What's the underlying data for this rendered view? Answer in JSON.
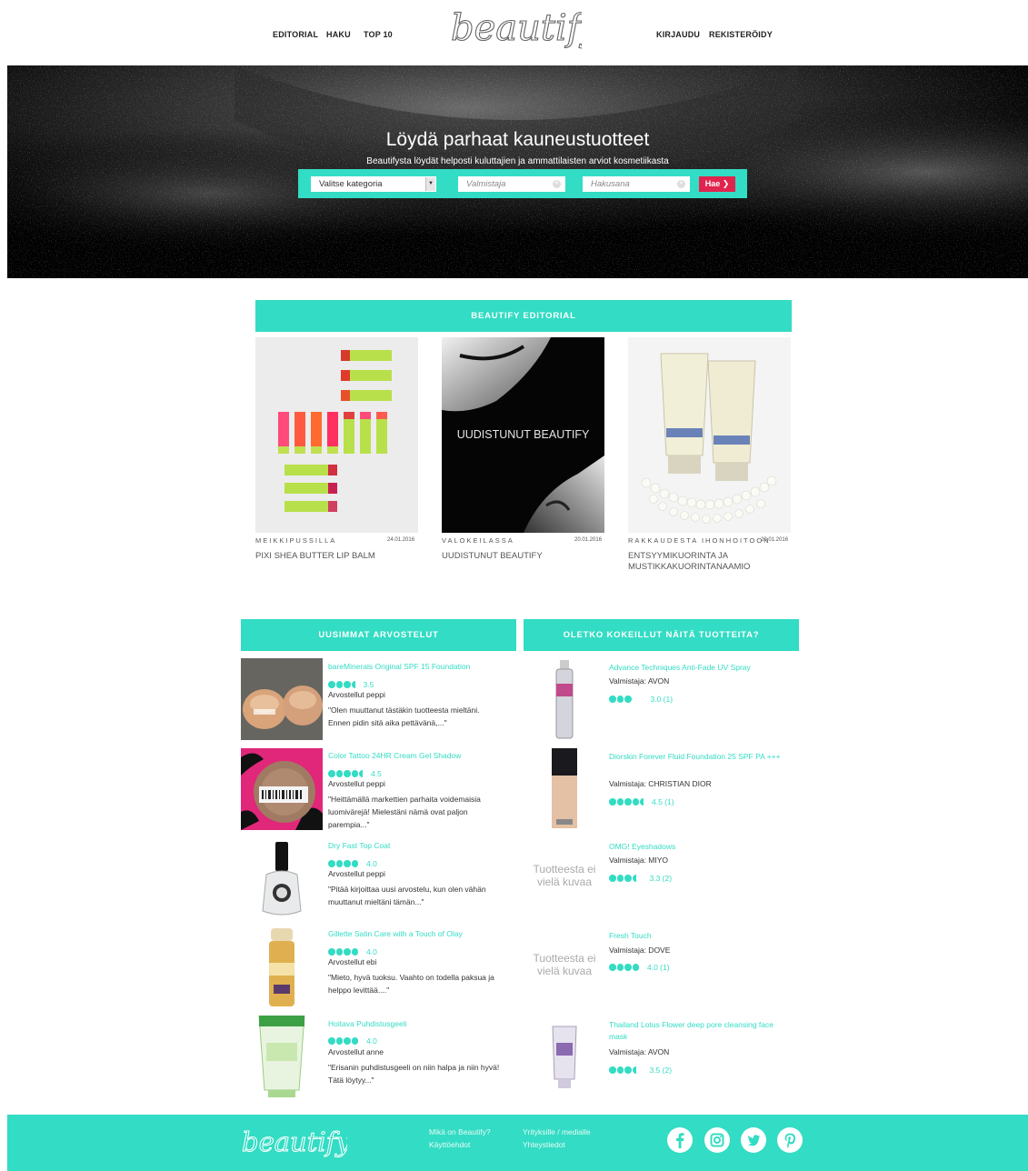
{
  "nav": {
    "left": [
      "EDITORIAL",
      "HAKU",
      "TOP 10"
    ],
    "right": [
      "KIRJAUDU",
      "REKISTERÖIDY"
    ]
  },
  "brand": {
    "logo_text": "beautify",
    "accent_color": "#33dcc4",
    "button_color": "#e0244e"
  },
  "hero": {
    "title": "Löydä parhaat kauneustuotteet",
    "subtitle": "Beautifysta löydät helposti kuluttajien ja ammattilaisten arviot kosmetiikasta",
    "category_value": "Valitse kategoria",
    "maker_placeholder": "Valmistaja",
    "keyword_placeholder": "Hakusana",
    "search_button": "Hae",
    "search_button_icon": "chevron-right-icon"
  },
  "editorial": {
    "heading": "BEAUTIFY EDITORIAL",
    "items": [
      {
        "category": "MEIKKIPUSSILLA",
        "date": "24.01.2016",
        "title": "PIXI SHEA BUTTER LIP BALM"
      },
      {
        "category": "VALOKEILASSA",
        "date": "20.01.2016",
        "title": "UUDISTUNUT BEAUTIFY",
        "image_text": "UUDISTUNUT BEAUTIFY"
      },
      {
        "category": "RAKKAUDESTA IHONHOITOON",
        "date": "20.01.2016",
        "title": "ENTSYYMIKUORINTA JA MUSTIKKAKUORINTANAAMIO"
      }
    ]
  },
  "reviews": {
    "heading": "UUSIMMAT ARVOSTELUT",
    "items": [
      {
        "product": "bareMinerals Original SPF 15 Foundation",
        "rating": 3.5,
        "rating_text": "3.5",
        "by": "Arvostellut peppi",
        "quote": "\"Olen muuttanut tästäkin tuotteesta mieltäni. Ennen pidin sitä aika pettävänä,...\""
      },
      {
        "product": "Color Tattoo 24HR Cream Gel Shadow",
        "rating": 4.5,
        "rating_text": "4.5",
        "by": "Arvostellut peppi",
        "quote": "\"Heittämällä markettien parhaita voidemaisia luomivärejä! Mielestäni nämä ovat paljon parempia...\""
      },
      {
        "product": "Dry Fast Top Coat",
        "rating": 4.0,
        "rating_text": "4.0",
        "by": "Arvostellut peppi",
        "quote": "\"Pitää kirjoittaa uusi arvostelu, kun olen vähän muuttanut mieltäni tämän...\""
      },
      {
        "product": "Gillette Satin Care with a Touch of Olay",
        "rating": 4.0,
        "rating_text": "4.0",
        "by": "Arvostellut ebi",
        "quote": "\"Mieto, hyvä tuoksu. Vaahto on todella paksua ja helppo levittää....\""
      },
      {
        "product": "Hoitava Puhdistusgeeli",
        "rating": 4.0,
        "rating_text": "4.0",
        "by": "Arvostellut anne",
        "quote": "\"Erisanin puhdistusgeeli on niin halpa ja niin hyvä! Tätä löytyy...\""
      }
    ]
  },
  "products": {
    "heading": "OLETKO KOKEILLUT NÄITÄ TUOTTEITA?",
    "no_image_text": "Tuotteesta ei vielä kuvaa",
    "items": [
      {
        "name": "Advance Techniques Anti-Fade UV Spray",
        "maker": "Valmistaja: AVON",
        "rating": 3.0,
        "rating_text": "3.0 (1)"
      },
      {
        "name": "Diorskin Forever Fluid Foundation 25 SPF PA +++",
        "maker": "Valmistaja: CHRISTIAN DIOR",
        "rating": 4.5,
        "rating_text": "4.5 (1)"
      },
      {
        "name": "OMG! Eyeshadows",
        "maker": "Valmistaja: MIYO",
        "rating": 3.3,
        "rating_text": "3.3 (2)"
      },
      {
        "name": "Fresh Touch",
        "maker": "Valmistaja: DOVE",
        "rating": 4.0,
        "rating_text": "4.0 (1)"
      },
      {
        "name": "Thailand Lotus Flower deep pore cleansing face mask",
        "maker": "Valmistaja: AVON",
        "rating": 3.5,
        "rating_text": "3.5 (2)"
      }
    ]
  },
  "footer": {
    "logo_text": "beautify",
    "links": [
      "Mikä on Beautify?",
      "Käyttöehdot",
      "Yrityksille / medialle",
      "Yhteystiedot"
    ],
    "social_icons": [
      "facebook-icon",
      "instagram-icon",
      "twitter-icon",
      "pinterest-icon"
    ]
  }
}
